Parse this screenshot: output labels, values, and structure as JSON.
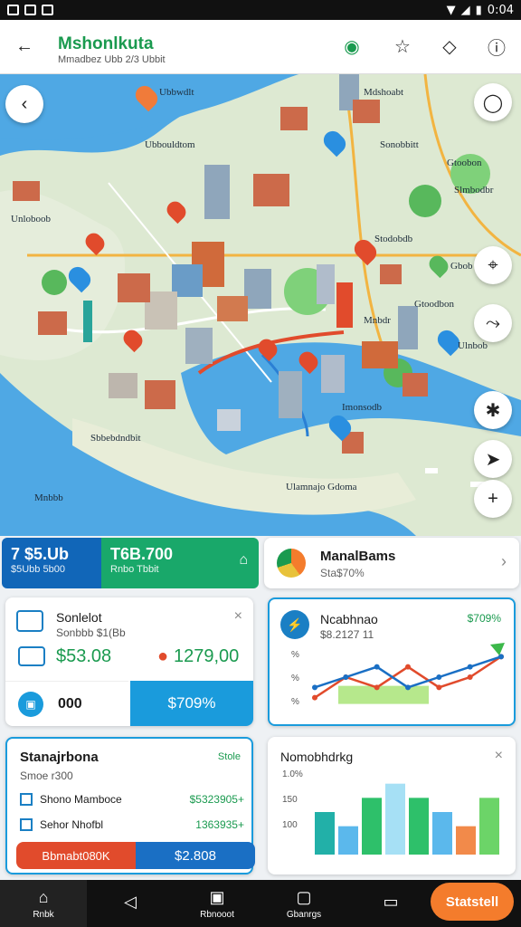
{
  "status": {
    "time": "0:04"
  },
  "appbar": {
    "title": "Mshonlkuta",
    "subtitle": "Mmadbez Ubb 2/3 Ubbit"
  },
  "map": {
    "labels": [
      "Ubbwdlt",
      "Ubbouldtom",
      "Mdshoabt",
      "Sonobbitt",
      "Gtoobon",
      "Slmbodbr",
      "Unloboob",
      "Stodobdb",
      "Gbob",
      "Gtoodbon",
      "Mnbdr",
      "Ulnbob",
      "Imonsodb",
      "Sbbebdndbit",
      "Ulamnajo Gdoma",
      "Mnbbb"
    ]
  },
  "cards": {
    "summary": {
      "left_value": "7 $5.Ub",
      "left_sub": "$5Ubb 5b00",
      "right_value": "T6B.700",
      "right_sub": "Rnbo Tbbit"
    },
    "manage": {
      "title": "ManalBams",
      "sub": "Sta$70%"
    },
    "schedule": {
      "title": "Sonlelot",
      "sub": "Sonbbb $1(Bb",
      "price": "$53.08",
      "value2": "1279,00",
      "row_label": "000",
      "row_button": "$709%"
    },
    "analytics": {
      "title": "Ncabhnao",
      "sub": "$8.2127 11",
      "badge": "$709%",
      "y_ticks": [
        "%",
        "%",
        "%"
      ]
    },
    "stats": {
      "title": "Stanajrbona",
      "sub": "Smoe r300",
      "badge": "Stole",
      "row1_label": "Shono Mamboce",
      "row1_value": "$5323905+",
      "row2_label": "Sehor Nhofbl",
      "row2_value": "1363935+",
      "bar_left": "Bbmabt080K",
      "bar_right": "$2.808"
    },
    "bars": {
      "title": "Nomobhdrkg",
      "y_ticks": [
        "1.0%",
        "150",
        "100"
      ]
    }
  },
  "chart_data": [
    {
      "type": "line",
      "title": "Ncabhnao",
      "series": [
        {
          "values": [
            1,
            3,
            2,
            4,
            2,
            3,
            5
          ]
        },
        {
          "values": [
            2,
            3,
            4,
            2,
            3,
            4,
            5
          ]
        }
      ]
    },
    {
      "type": "bar",
      "title": "Nomobhdrkg",
      "values": [
        3,
        2,
        4,
        5,
        4,
        3,
        2,
        4
      ]
    }
  ],
  "nav": {
    "items": [
      "Rnbk",
      "",
      "Rbnooot",
      "Gbanrgs",
      ""
    ],
    "start": "Statstell"
  },
  "colors": {
    "accent": "#1a9a4f",
    "blue": "#1a9bdc",
    "orange": "#f47c2c",
    "red": "#e14b2c"
  }
}
